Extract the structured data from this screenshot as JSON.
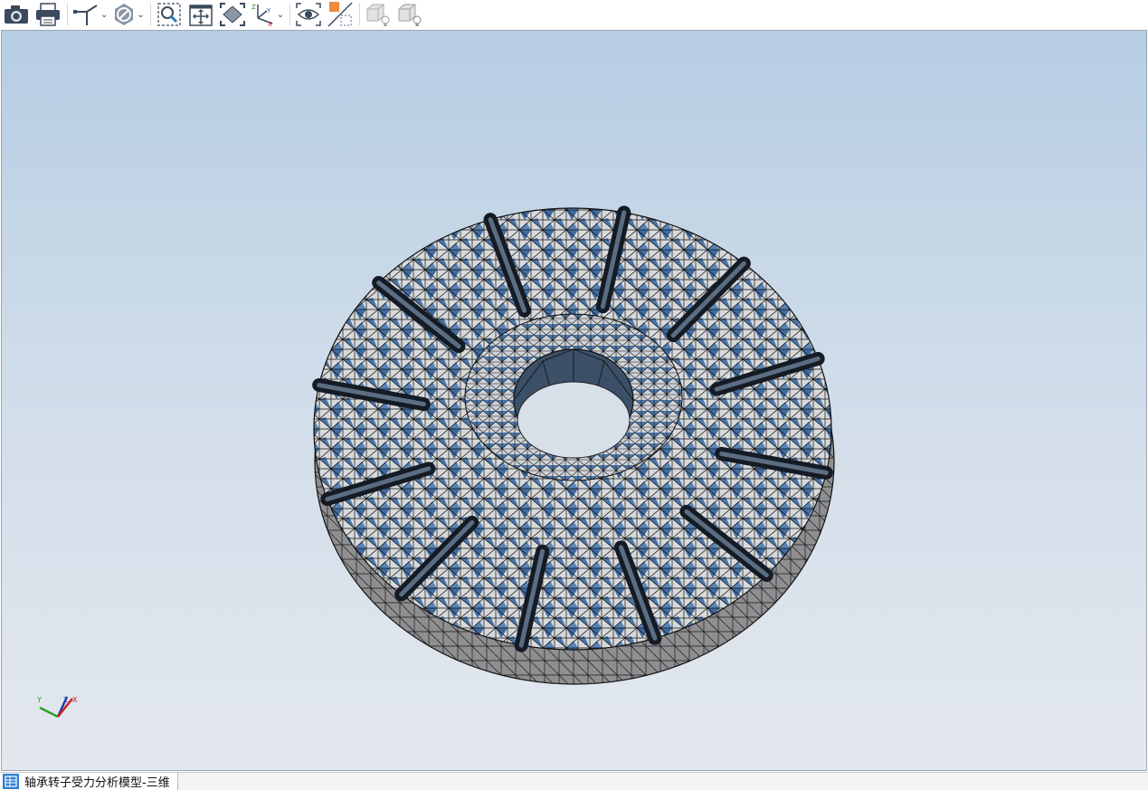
{
  "toolbar": {
    "buttons": [
      {
        "name": "camera-icon"
      },
      {
        "name": "print-icon"
      },
      {
        "name": "axis-triad-icon",
        "dropdown": true
      },
      {
        "name": "clip-disable-icon",
        "dropdown": true
      },
      {
        "name": "zoom-window-icon"
      },
      {
        "name": "pan-icon"
      },
      {
        "name": "fit-view-icon"
      },
      {
        "name": "view-orientation-icon",
        "dropdown": true
      },
      {
        "name": "eye-view-icon"
      },
      {
        "name": "section-plane-icon"
      },
      {
        "name": "light-icon"
      },
      {
        "name": "light-icon"
      }
    ]
  },
  "viewport": {
    "model": "bearing-rotor-mesh",
    "slot_count": 12,
    "colors": {
      "background_top": "#b6cde3",
      "background_bottom": "#e4e8ee",
      "mesh_face": "#d9d9d9",
      "mesh_shade": "#3e6a9e",
      "mesh_edge": "#111111"
    },
    "triad": {
      "x_label": "X",
      "y_label": "Y",
      "z_label": "Z"
    }
  },
  "status": {
    "tab_label": "轴承转子受力分析模型-三维"
  }
}
